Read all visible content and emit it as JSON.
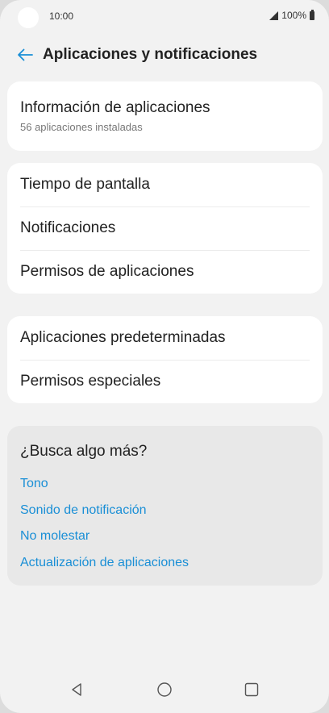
{
  "status_bar": {
    "time": "10:00",
    "battery": "100%"
  },
  "header": {
    "title": "Aplicaciones y notificaciones"
  },
  "app_info": {
    "title": "Información de aplicaciones",
    "subtitle": "56 aplicaciones instaladas"
  },
  "group1": {
    "items": [
      {
        "label": "Tiempo de pantalla"
      },
      {
        "label": "Notificaciones"
      },
      {
        "label": "Permisos de aplicaciones"
      }
    ]
  },
  "group2": {
    "items": [
      {
        "label": "Aplicaciones predeterminadas"
      },
      {
        "label": "Permisos especiales"
      }
    ]
  },
  "suggestions": {
    "title": "¿Busca algo más?",
    "links": [
      {
        "label": "Tono"
      },
      {
        "label": "Sonido de notificación"
      },
      {
        "label": "No molestar"
      },
      {
        "label": "Actualización de aplicaciones"
      }
    ]
  },
  "colors": {
    "accent": "#1a8fd6",
    "background": "#f2f2f2",
    "card": "#ffffff",
    "suggestion_card": "#e8e8e8"
  },
  "icons": {
    "back": "arrow-left-icon",
    "signal": "signal-icon",
    "battery": "battery-icon",
    "nav_back": "triangle-back-icon",
    "nav_home": "circle-home-icon",
    "nav_recents": "square-recents-icon"
  }
}
